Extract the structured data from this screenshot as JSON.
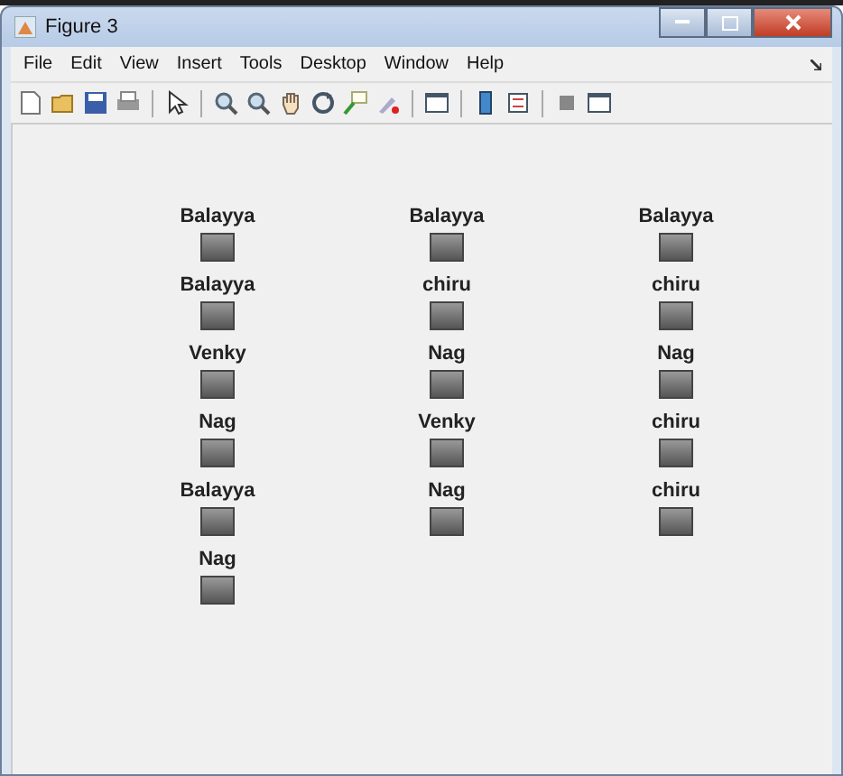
{
  "window": {
    "title": "Figure 3"
  },
  "menu": [
    "File",
    "Edit",
    "View",
    "Insert",
    "Tools",
    "Desktop",
    "Window",
    "Help"
  ],
  "tiles": [
    {
      "label": "Balayya"
    },
    {
      "label": "Balayya"
    },
    {
      "label": "Balayya"
    },
    {
      "label": "Balayya"
    },
    {
      "label": "chiru"
    },
    {
      "label": "chiru"
    },
    {
      "label": "Venky"
    },
    {
      "label": "Nag"
    },
    {
      "label": "Nag"
    },
    {
      "label": "Nag"
    },
    {
      "label": "Venky"
    },
    {
      "label": "chiru"
    },
    {
      "label": "Balayya"
    },
    {
      "label": "Nag"
    },
    {
      "label": "chiru"
    },
    {
      "label": "Nag"
    }
  ]
}
